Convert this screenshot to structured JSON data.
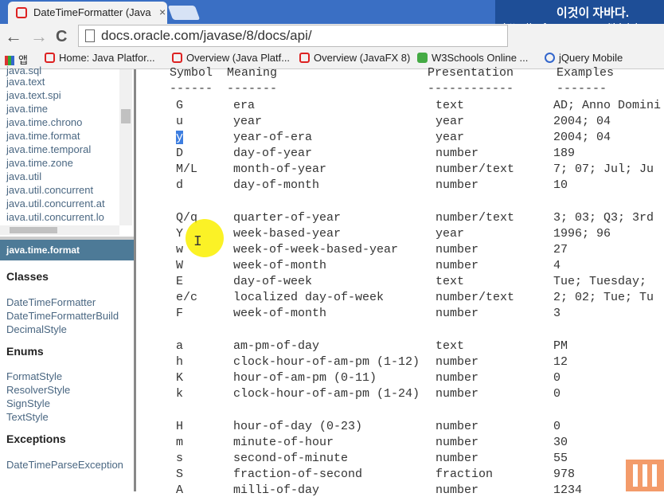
{
  "tab": {
    "title": "DateTimeFormatter (Java",
    "close": "×"
  },
  "overlay": {
    "line1": "이것이 자바다.",
    "line2": "http://cafe.naver.com/thisisjav"
  },
  "nav": {
    "back": "←",
    "forward": "→",
    "reload": "C"
  },
  "address": {
    "url": "docs.oracle.com/javase/8/docs/api/"
  },
  "bookmarks": [
    {
      "label": "앱"
    },
    {
      "label": "Home: Java Platfor..."
    },
    {
      "label": "Overview (Java Platf..."
    },
    {
      "label": "Overview (JavaFX 8)"
    },
    {
      "label": "W3Schools Online ..."
    },
    {
      "label": "jQuery Mobile"
    }
  ],
  "sidebar": {
    "packages": [
      "java.sql",
      "java.text",
      "java.text.spi",
      "java.time",
      "java.time.chrono",
      "java.time.format",
      "java.time.temporal",
      "java.time.zone",
      "java.util",
      "java.util.concurrent",
      "java.util.concurrent.at",
      "java.util.concurrent.lo"
    ],
    "current_package": "java.time.format",
    "classes_heading": "Classes",
    "classes": [
      "DateTimeFormatter",
      "DateTimeFormatterBuild",
      "DecimalStyle"
    ],
    "enums_heading": "Enums",
    "enums": [
      "FormatStyle",
      "ResolverStyle",
      "SignStyle",
      "TextStyle"
    ],
    "exceptions_heading": "Exceptions",
    "exceptions": [
      "DateTimeParseException"
    ]
  },
  "table": {
    "headers": [
      "Symbol",
      "Meaning",
      "Presentation",
      "Examples"
    ],
    "rule": [
      "------",
      "-------",
      "------------",
      "-------"
    ],
    "groups": [
      [
        [
          "G",
          "era",
          "text",
          "AD; Anno Domini"
        ],
        [
          "u",
          "year",
          "year",
          "2004; 04"
        ],
        [
          "y",
          "year-of-era",
          "year",
          "2004; 04"
        ],
        [
          "D",
          "day-of-year",
          "number",
          "189"
        ],
        [
          "M/L",
          "month-of-year",
          "number/text",
          "7; 07; Jul; Ju"
        ],
        [
          "d",
          "day-of-month",
          "number",
          "10"
        ]
      ],
      [
        [
          "Q/q",
          "quarter-of-year",
          "number/text",
          "3; 03; Q3; 3rd"
        ],
        [
          "Y",
          "week-based-year",
          "year",
          "1996; 96"
        ],
        [
          "w",
          "week-of-week-based-year",
          "number",
          "27"
        ],
        [
          "W",
          "week-of-month",
          "number",
          "4"
        ],
        [
          "E",
          "day-of-week",
          "text",
          "Tue; Tuesday;"
        ],
        [
          "e/c",
          "localized day-of-week",
          "number/text",
          "2; 02; Tue; Tu"
        ],
        [
          "F",
          "week-of-month",
          "number",
          "3"
        ]
      ],
      [
        [
          "a",
          "am-pm-of-day",
          "text",
          "PM"
        ],
        [
          "h",
          "clock-hour-of-am-pm (1-12)",
          "number",
          "12"
        ],
        [
          "K",
          "hour-of-am-pm (0-11)",
          "number",
          "0"
        ],
        [
          "k",
          "clock-hour-of-am-pm (1-24)",
          "number",
          "0"
        ]
      ],
      [
        [
          "H",
          "hour-of-day (0-23)",
          "number",
          "0"
        ],
        [
          "m",
          "minute-of-hour",
          "number",
          "30"
        ],
        [
          "s",
          "second-of-minute",
          "number",
          "55"
        ],
        [
          "S",
          "fraction-of-second",
          "fraction",
          "978"
        ],
        [
          "A",
          "milli-of-day",
          "number",
          "1234"
        ]
      ]
    ]
  }
}
